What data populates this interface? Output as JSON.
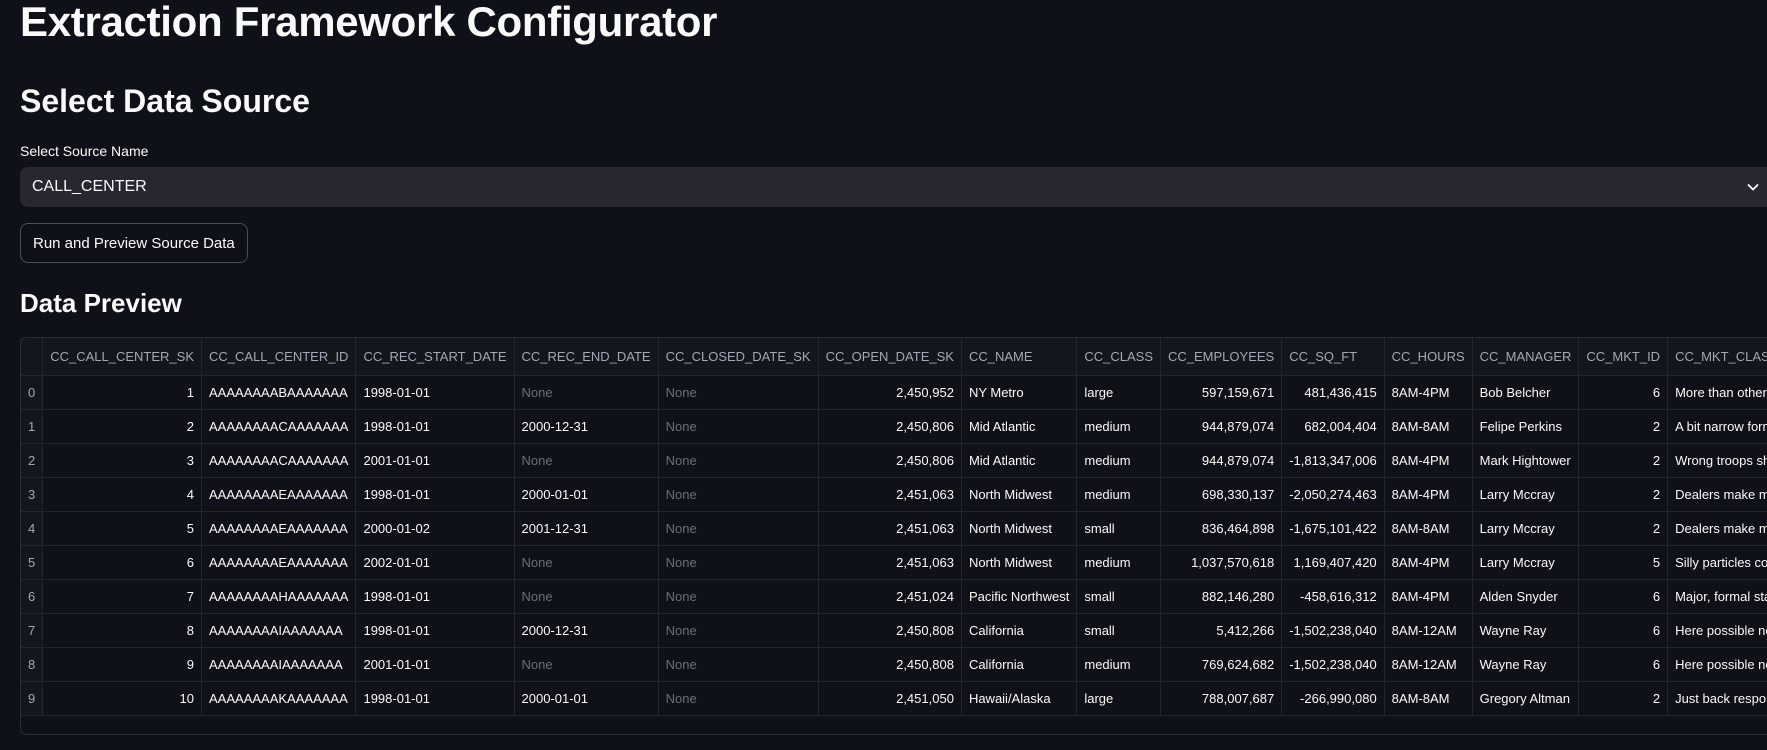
{
  "app": {
    "title": "Extraction Framework Configurator"
  },
  "source_section": {
    "title": "Select Data Source",
    "select_label": "Select Source Name",
    "selected_value": "CALL_CENTER",
    "run_button_label": "Run and Preview Source Data"
  },
  "preview_section": {
    "title": "Data Preview"
  },
  "table": {
    "columns": [
      "",
      "CC_CALL_CENTER_SK",
      "CC_CALL_CENTER_ID",
      "CC_REC_START_DATE",
      "CC_REC_END_DATE",
      "CC_CLOSED_DATE_SK",
      "CC_OPEN_DATE_SK",
      "CC_NAME",
      "CC_CLASS",
      "CC_EMPLOYEES",
      "CC_SQ_FT",
      "CC_HOURS",
      "CC_MANAGER",
      "CC_MKT_ID",
      "CC_MKT_CLASS"
    ],
    "rows": [
      [
        "0",
        "1",
        "AAAAAAAABAAAAAAA",
        "1998-01-01",
        "None",
        "None",
        "2,450,952",
        "NY Metro",
        "large",
        "597,159,671",
        "481,436,415",
        "8AM-4PM",
        "Bob Belcher",
        "6",
        "More than other authori"
      ],
      [
        "1",
        "2",
        "AAAAAAAACAAAAAAA",
        "1998-01-01",
        "2000-12-31",
        "None",
        "2,450,806",
        "Mid Atlantic",
        "medium",
        "944,879,074",
        "682,004,404",
        "8AM-8AM",
        "Felipe Perkins",
        "2",
        "A bit narrow forms matter ar"
      ],
      [
        "2",
        "3",
        "AAAAAAAACAAAAAAA",
        "2001-01-01",
        "None",
        "None",
        "2,450,806",
        "Mid Atlantic",
        "medium",
        "944,879,074",
        "-1,813,347,006",
        "8AM-4PM",
        "Mark Hightower",
        "2",
        "Wrong troops shall work som"
      ],
      [
        "3",
        "4",
        "AAAAAAAAEAAAAAAA",
        "1998-01-01",
        "2000-01-01",
        "None",
        "2,451,063",
        "North Midwest",
        "medium",
        "698,330,137",
        "-2,050,274,463",
        "8AM-4PM",
        "Larry Mccray",
        "2",
        "Dealers make most historica"
      ],
      [
        "4",
        "5",
        "AAAAAAAAEAAAAAAA",
        "2000-01-02",
        "2001-12-31",
        "None",
        "2,451,063",
        "North Midwest",
        "small",
        "836,464,898",
        "-1,675,101,422",
        "8AM-8AM",
        "Larry Mccray",
        "2",
        "Dealers make most historica"
      ],
      [
        "5",
        "6",
        "AAAAAAAAEAAAAAAA",
        "2002-01-01",
        "None",
        "None",
        "2,451,063",
        "North Midwest",
        "medium",
        "1,037,570,618",
        "1,169,407,420",
        "8AM-4PM",
        "Larry Mccray",
        "5",
        "Silly particles could pro"
      ],
      [
        "6",
        "7",
        "AAAAAAAAHAAAAAAA",
        "1998-01-01",
        "None",
        "None",
        "2,451,024",
        "Pacific Northwest",
        "small",
        "882,146,280",
        "-458,616,312",
        "8AM-4PM",
        "Alden Snyder",
        "6",
        "Major, formal states can supp"
      ],
      [
        "7",
        "8",
        "AAAAAAAAIAAAAAAA",
        "1998-01-01",
        "2000-12-31",
        "None",
        "2,450,808",
        "California",
        "small",
        "5,412,266",
        "-1,502,238,040",
        "8AM-12AM",
        "Wayne Ray",
        "6",
        "Here possible notions arrive"
      ],
      [
        "8",
        "9",
        "AAAAAAAAIAAAAAAA",
        "2001-01-01",
        "None",
        "None",
        "2,450,808",
        "California",
        "medium",
        "769,624,682",
        "-1,502,238,040",
        "8AM-12AM",
        "Wayne Ray",
        "6",
        "Here possible notions arrive"
      ],
      [
        "9",
        "10",
        "AAAAAAAAKAAAAAAA",
        "1998-01-01",
        "2000-01-01",
        "None",
        "2,451,050",
        "Hawaii/Alaska",
        "large",
        "788,007,687",
        "-266,990,080",
        "8AM-8AM",
        "Gregory Altman",
        "2",
        "Just back responses ought"
      ]
    ]
  }
}
